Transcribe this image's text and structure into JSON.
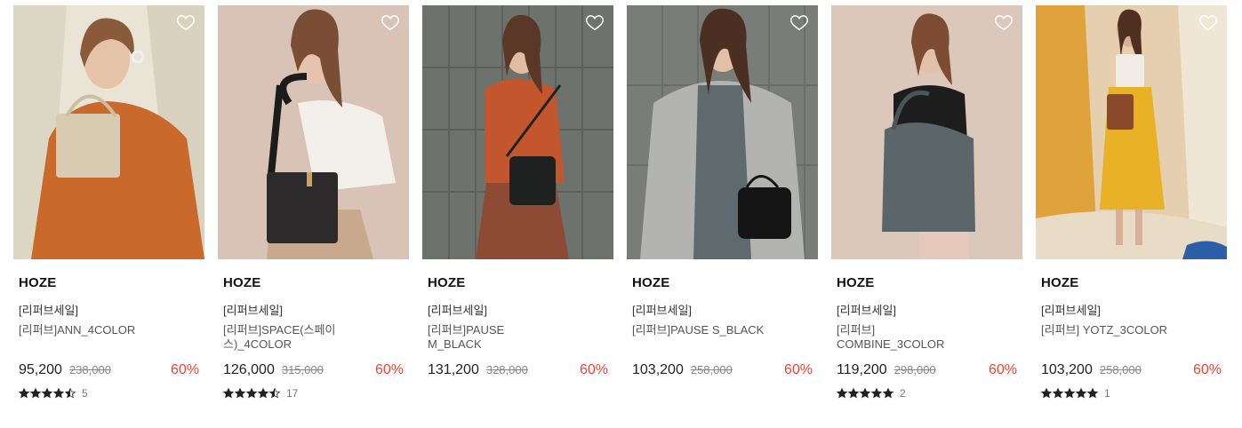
{
  "products": [
    {
      "brand": "HOZE",
      "tag": "[리퍼브세일]",
      "name": "[리퍼브]ANN_4COLOR",
      "price": "95,200",
      "original_price": "238,000",
      "discount": "60%",
      "rating": 4.5,
      "review_count": "5"
    },
    {
      "brand": "HOZE",
      "tag": "[리퍼브세일]",
      "name": "[리퍼브]SPACE(스페이스)_4COLOR",
      "price": "126,000",
      "original_price": "315,000",
      "discount": "60%",
      "rating": 4.5,
      "review_count": "17"
    },
    {
      "brand": "HOZE",
      "tag": "[리퍼브세일]",
      "name": "[리퍼브]PAUSE M_BLACK",
      "price": "131,200",
      "original_price": "328,000",
      "discount": "60%"
    },
    {
      "brand": "HOZE",
      "tag": "[리퍼브세일]",
      "name": "[리퍼브]PAUSE S_BLACK",
      "price": "103,200",
      "original_price": "258,000",
      "discount": "60%"
    },
    {
      "brand": "HOZE",
      "tag": "[리퍼브세일]",
      "name": "[리퍼브] COMBINE_3COLOR",
      "price": "119,200",
      "original_price": "298,000",
      "discount": "60%",
      "rating": 5,
      "review_count": "2"
    },
    {
      "brand": "HOZE",
      "tag": "[리퍼브세일]",
      "name": "[리퍼브] YOTZ_3COLOR",
      "price": "103,200",
      "original_price": "258,000",
      "discount": "60%",
      "rating": 5,
      "review_count": "1"
    }
  ],
  "colors": {
    "discount": "#e8483a",
    "star": "#222222"
  },
  "icons": {
    "wishlist": "heart-outline-icon",
    "rating": "star-icon"
  }
}
